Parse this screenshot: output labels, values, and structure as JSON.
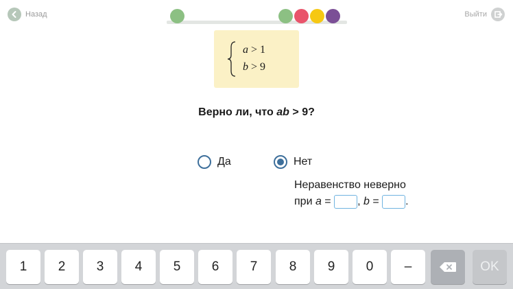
{
  "topbar": {
    "back_label": "Назад",
    "back_icon": "chevron-left-icon",
    "exit_label": "Выйти",
    "exit_icon": "exit-icon"
  },
  "progress": {
    "dots": [
      {
        "color": "#8cc083"
      },
      {
        "color": "#8cc083"
      },
      {
        "color": "#e9546b"
      },
      {
        "color": "#f6c813"
      },
      {
        "color": "#7b4f96"
      }
    ]
  },
  "condition": {
    "line1": {
      "var": "a",
      "rest": " > 1"
    },
    "line2": {
      "var": "b",
      "rest": " > 9"
    }
  },
  "question": {
    "prefix": "Верно ли, что ",
    "var": "ab",
    "suffix": " > 9?"
  },
  "options": [
    {
      "label": "Да",
      "selected": false
    },
    {
      "label": "Нет",
      "selected": true
    }
  ],
  "explanation": {
    "line1": "Неравенство неверно",
    "line2_prefix": "при ",
    "var_a": "a",
    "eq": " = ",
    "sep": ", ",
    "var_b": "b",
    "end": "."
  },
  "keyboard": {
    "keys": [
      "1",
      "2",
      "3",
      "4",
      "5",
      "6",
      "7",
      "8",
      "9",
      "0",
      "–"
    ],
    "backspace_icon": "backspace-icon",
    "ok_label": "OK"
  },
  "colors": {
    "accent": "#3d6f9b",
    "condition_bg": "#fbf1c6",
    "answer_border": "#6fb3e0"
  }
}
